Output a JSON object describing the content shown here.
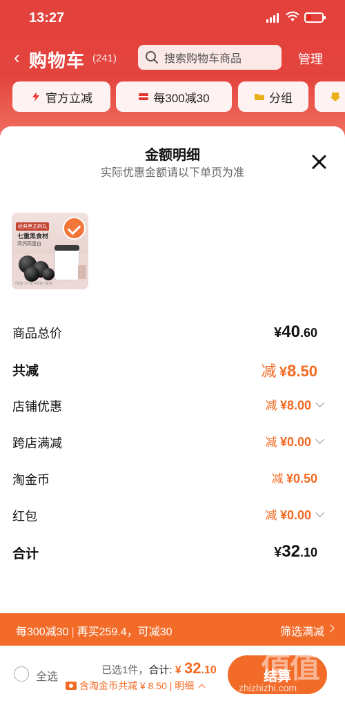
{
  "status_bar": {
    "time": "13:27"
  },
  "nav": {
    "back_glyph": "‹",
    "title": "购物车",
    "count": "(241)",
    "search_placeholder": "搜索购物车商品",
    "manage": "管理"
  },
  "chips": [
    {
      "label": "官方立减",
      "icon": "lightning-icon"
    },
    {
      "label": "每300减30",
      "icon": "coupon-icon"
    },
    {
      "label": "分组",
      "icon": "folder-icon"
    }
  ],
  "sheet": {
    "title": "金额明细",
    "subtitle": "实际优惠金额请以下单页为准",
    "product": {
      "tag": "经典黑芝麻丸",
      "name": "七重黑食材",
      "desc": "高钙高蛋白",
      "fine_print": "7颗装  3斤装  4瓶装  5盒装"
    },
    "rows": [
      {
        "label": "商品总价",
        "prefix": "",
        "yen": "¥",
        "int": "40",
        "dec": ".60",
        "style": "total",
        "chevron": false
      },
      {
        "label": "共减",
        "prefix": "减",
        "yen": "¥",
        "int": "8",
        "dec": ".50",
        "style": "discount-big",
        "chevron": false
      },
      {
        "label": "店铺优惠",
        "prefix": "减",
        "yen": "¥",
        "int": "8",
        "dec": ".00",
        "style": "discount",
        "chevron": true
      },
      {
        "label": "跨店满减",
        "prefix": "减",
        "yen": "¥",
        "int": "0",
        "dec": ".00",
        "style": "discount",
        "chevron": true
      },
      {
        "label": "淘金币",
        "prefix": "减",
        "yen": "¥",
        "int": "0",
        "dec": ".50",
        "style": "discount",
        "chevron": false
      },
      {
        "label": "红包",
        "prefix": "减",
        "yen": "¥",
        "int": "0",
        "dec": ".00",
        "style": "discount",
        "chevron": true
      },
      {
        "label": "合计",
        "prefix": "",
        "yen": "¥",
        "int": "32",
        "dec": ".10",
        "style": "total",
        "chevron": false
      }
    ]
  },
  "promo": {
    "part1": "每300减30",
    "part2": "再买259.4，可减30",
    "filter": "筛选满减"
  },
  "checkout": {
    "select_all": "全选",
    "selected": "已选1件，",
    "total_label": "合计:",
    "total_yen": "¥",
    "total_int": "32",
    "total_dec": ".10",
    "coin_text": "含淘金币共减 ¥ 8.50 | 明细",
    "settle": "结算"
  },
  "watermark": {
    "big": "值值值",
    "url": "zhizhizhi.com"
  },
  "colors": {
    "brand_red": "#e3413b",
    "accent_orange": "#f26b28"
  }
}
